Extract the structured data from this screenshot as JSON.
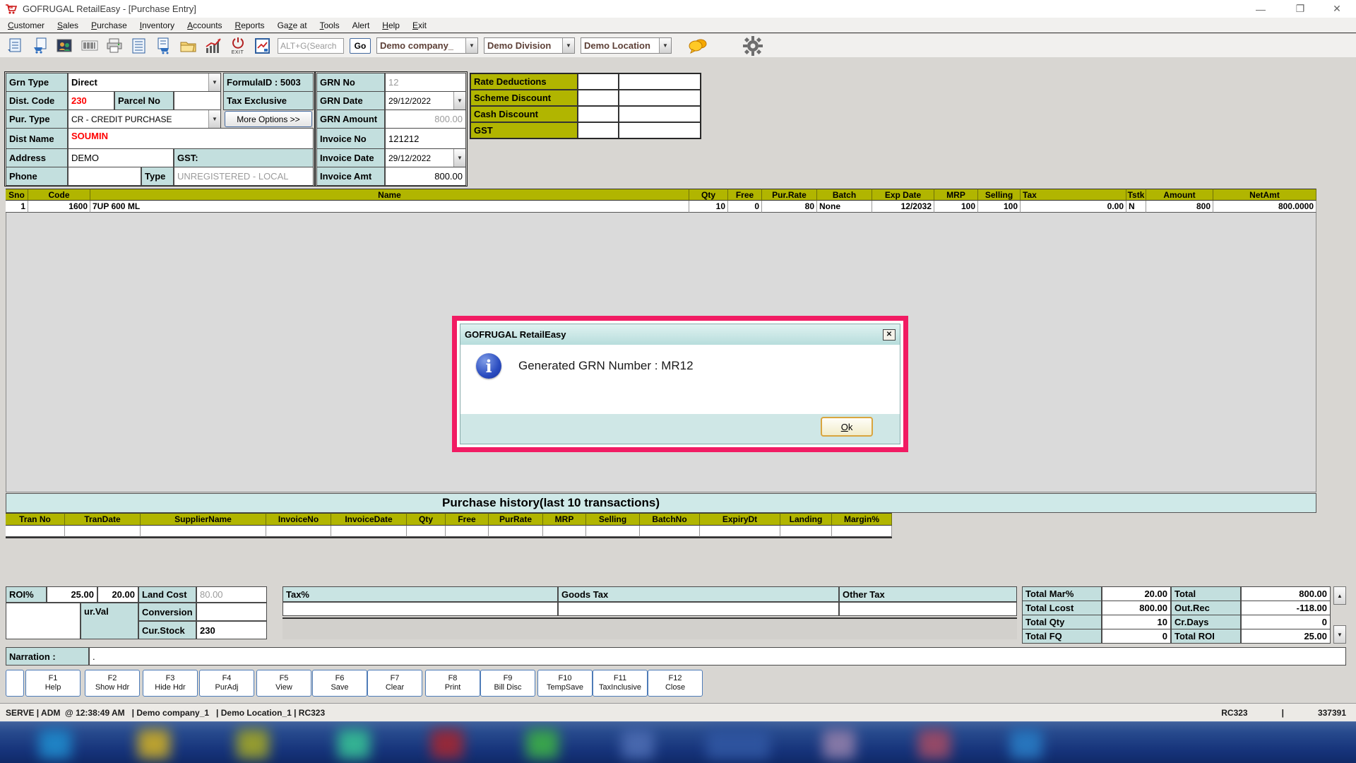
{
  "colors": {
    "accent_pink": "#f11b63",
    "olive_header": "#b1b500",
    "teal_label": "#c3dfde",
    "teal_band": "#cfe9e8"
  },
  "titlebar": {
    "title": "GOFRUGAL RetailEasy - [Purchase Entry]",
    "minimize": "—",
    "restore": "❐",
    "close": "✕"
  },
  "menu": {
    "items": [
      {
        "pre": "",
        "u": "C",
        "post": "ustomer"
      },
      {
        "pre": "",
        "u": "S",
        "post": "ales"
      },
      {
        "pre": "",
        "u": "P",
        "post": "urchase"
      },
      {
        "pre": "",
        "u": "I",
        "post": "nventory"
      },
      {
        "pre": "",
        "u": "A",
        "post": "ccounts"
      },
      {
        "pre": "",
        "u": "R",
        "post": "eports"
      },
      {
        "pre": "Ga",
        "u": "z",
        "post": "e at"
      },
      {
        "pre": "",
        "u": "T",
        "post": "ools"
      },
      {
        "pre": "",
        "u": "",
        "post": "Alert"
      },
      {
        "pre": "",
        "u": "H",
        "post": "elp"
      },
      {
        "pre": "",
        "u": "E",
        "post": "xit"
      }
    ]
  },
  "toolbar": {
    "search_value": "ALT+G(Search",
    "go_label": "Go",
    "company": "Demo company_",
    "division": "Demo Division",
    "location": "Demo Location",
    "exit_label": "EXIT",
    "arrow": "▼"
  },
  "form": {
    "grn_type_label": "Grn Type",
    "grn_type_value": "Direct",
    "formula_label": "FormulaID : 5003",
    "grn_no_label": "GRN No",
    "grn_no_value": "12",
    "dist_code_label": "Dist. Code",
    "dist_code_value": "230",
    "parcel_label": "Parcel No",
    "parcel_value": "",
    "tax_exclusive_label": "Tax Exclusive",
    "grn_date_label": "GRN Date",
    "grn_date_value": "29/12/2022",
    "pur_type_label": "Pur. Type",
    "pur_type_value": "CR - CREDIT PURCHASE",
    "more_options_label": "More Options >>",
    "grn_amount_label": "GRN Amount",
    "grn_amount_value": "800.00",
    "dist_name_label": "Dist Name",
    "dist_name_value": "SOUMIN",
    "invoice_no_label": "Invoice No",
    "invoice_no_value": "121212",
    "address_label": "Address",
    "address_value": "DEMO",
    "gst_label": "GST:",
    "invoice_date_label": "Invoice Date",
    "invoice_date_value": "29/12/2022",
    "phone_label": "Phone",
    "phone_value": "",
    "type_label": "Type",
    "type_value": "UNREGISTERED - LOCAL",
    "invoice_amt_label": "Invoice Amt",
    "invoice_amt_value": "800.00"
  },
  "deductions": {
    "rows": [
      "Rate Deductions",
      "Scheme Discount",
      "Cash Discount",
      "GST"
    ]
  },
  "items": {
    "headers": [
      "Sno",
      "Code",
      "Name",
      "Qty",
      "Free",
      "Pur.Rate",
      "Batch",
      "Exp Date",
      "MRP",
      "Selling",
      "Tax",
      "Tstk",
      "Amount",
      "NetAmt"
    ],
    "row": [
      "1",
      "1600",
      "7UP 600 ML",
      "10",
      "0",
      "80",
      "None",
      "12/2032",
      "100",
      "100",
      "0.00",
      "N",
      "800",
      "800.0000"
    ]
  },
  "dialog": {
    "title": "GOFRUGAL RetailEasy",
    "close": "✕",
    "info_glyph": "i",
    "message": "Generated GRN Number : MR12",
    "ok": {
      "u": "O",
      "rest": "k"
    }
  },
  "history": {
    "title": "Purchase history(last 10 transactions)",
    "headers": [
      "Tran No",
      "TranDate",
      "SupplierName",
      "InvoiceNo",
      "InvoiceDate",
      "Qty",
      "Free",
      "PurRate",
      "MRP",
      "Selling",
      "BatchNo",
      "ExpiryDt",
      "Landing",
      "Margin%"
    ]
  },
  "footer": {
    "roi_label": "ROI%",
    "roi_value1": "25.00",
    "roi_value2": "20.00",
    "land_cost_label": "Land Cost",
    "land_cost_value": "80.00",
    "cur_val_label": "ur.Val",
    "conversion_label": "Conversion",
    "conversion_value": "",
    "cur_stock_label": "Cur.Stock",
    "cur_stock_value": "230",
    "tax_label": "Tax%",
    "goods_tax_label": "Goods Tax",
    "other_tax_label": "Other Tax",
    "totals": [
      {
        "l1": "Total Mar%",
        "v1": "20.00",
        "l2": "Total",
        "v2": "800.00"
      },
      {
        "l1": "Total Lcost",
        "v1": "800.00",
        "l2": "Out.Rec",
        "v2": "-118.00"
      },
      {
        "l1": "Total Qty",
        "v1": "10",
        "l2": "Cr.Days",
        "v2": "0"
      },
      {
        "l1": "Total FQ",
        "v1": "0",
        "l2": "Total ROI",
        "v2": "25.00"
      }
    ],
    "scroll_up": "▲",
    "scroll_down": "▼",
    "narration_label": "Narration :",
    "narration_value": "."
  },
  "fkeys": [
    {
      "key": "F1",
      "label": "Help"
    },
    {
      "key": "F2",
      "label": "Show Hdr"
    },
    {
      "key": "F3",
      "label": "Hide Hdr"
    },
    {
      "key": "F4",
      "label": "PurAdj"
    },
    {
      "key": "F5",
      "label": "View"
    },
    {
      "key": "F6",
      "label": "Save"
    },
    {
      "key": "F7",
      "label": "Clear"
    },
    {
      "key": "F8",
      "label": "Print"
    },
    {
      "key": "F9",
      "label": "Bill Disc"
    },
    {
      "key": "F10",
      "label": "TempSave"
    },
    {
      "key": "F11",
      "label": "TaxInclusive"
    },
    {
      "key": "F12",
      "label": "Close"
    }
  ],
  "status": {
    "left": "SERVE | ADM  @ 12:38:49 AM   | Demo company_1   | Demo Location_1 | RC323",
    "right_code": "RC323",
    "right_sep": "|",
    "right_num": "337391"
  }
}
